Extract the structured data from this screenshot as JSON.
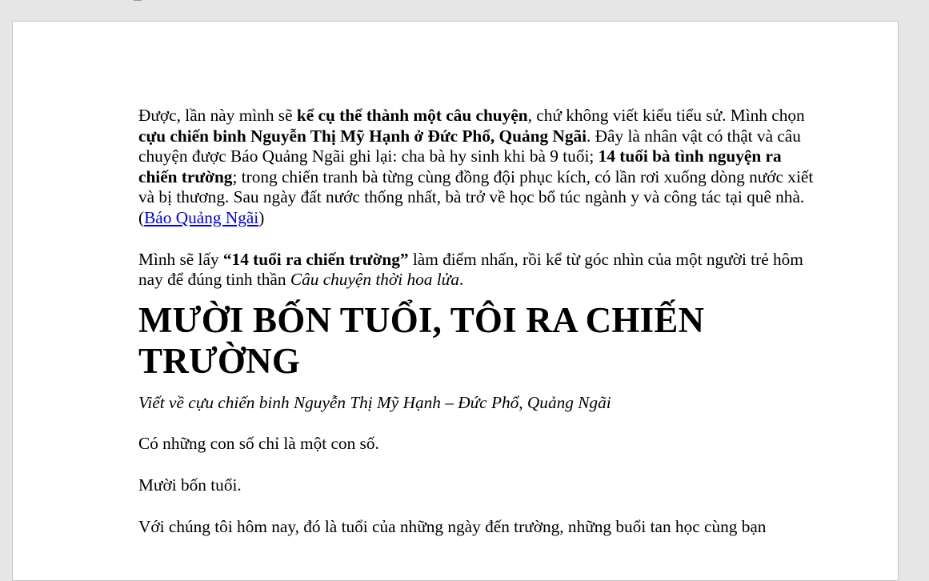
{
  "doc": {
    "p1": {
      "a": "Được, lần này mình sẽ ",
      "b": "kể cụ thể thành một câu chuyện",
      "c": ", chứ không viết kiểu tiểu sử. Mình chọn ",
      "d": "cựu chiến binh Nguyễn Thị Mỹ Hạnh ở Đức Phổ, Quảng Ngãi",
      "e": ". Đây là nhân vật có thật và câu chuyện được Báo Quảng Ngãi ghi lại: cha bà hy sinh khi bà 9 tuổi; ",
      "f": "14 tuổi bà tình nguyện ra chiến trường",
      "g": "; trong chiến tranh bà từng cùng đồng đội phục kích, có lần rơi xuống dòng nước xiết và bị thương. Sau ngày đất nước thống nhất, bà trở về học bổ túc ngành y và công tác tại quê nhà. (",
      "link": "Báo Quảng Ngãi",
      "h": ")"
    },
    "p2": {
      "a": "Mình sẽ lấy ",
      "b": "“14 tuổi ra chiến trường”",
      "c": " làm điểm nhấn, rồi kể từ góc nhìn của một người trẻ hôm nay để đúng tinh thần ",
      "d": "Câu chuyện thời hoa lửa",
      "e": "."
    },
    "heading": "MƯỜI BỐN TUỔI, TÔI RA CHIẾN TRƯỜNG",
    "subtitle": "Viết về cựu chiến binh Nguyễn Thị Mỹ Hạnh – Đức Phổ, Quảng Ngãi",
    "p3": "Có những con số chỉ là một con số.",
    "p4": "Mười bốn tuổi.",
    "p5": "Với chúng tôi hôm nay, đó là tuổi của những ngày đến trường, những buổi tan học cùng bạn"
  }
}
